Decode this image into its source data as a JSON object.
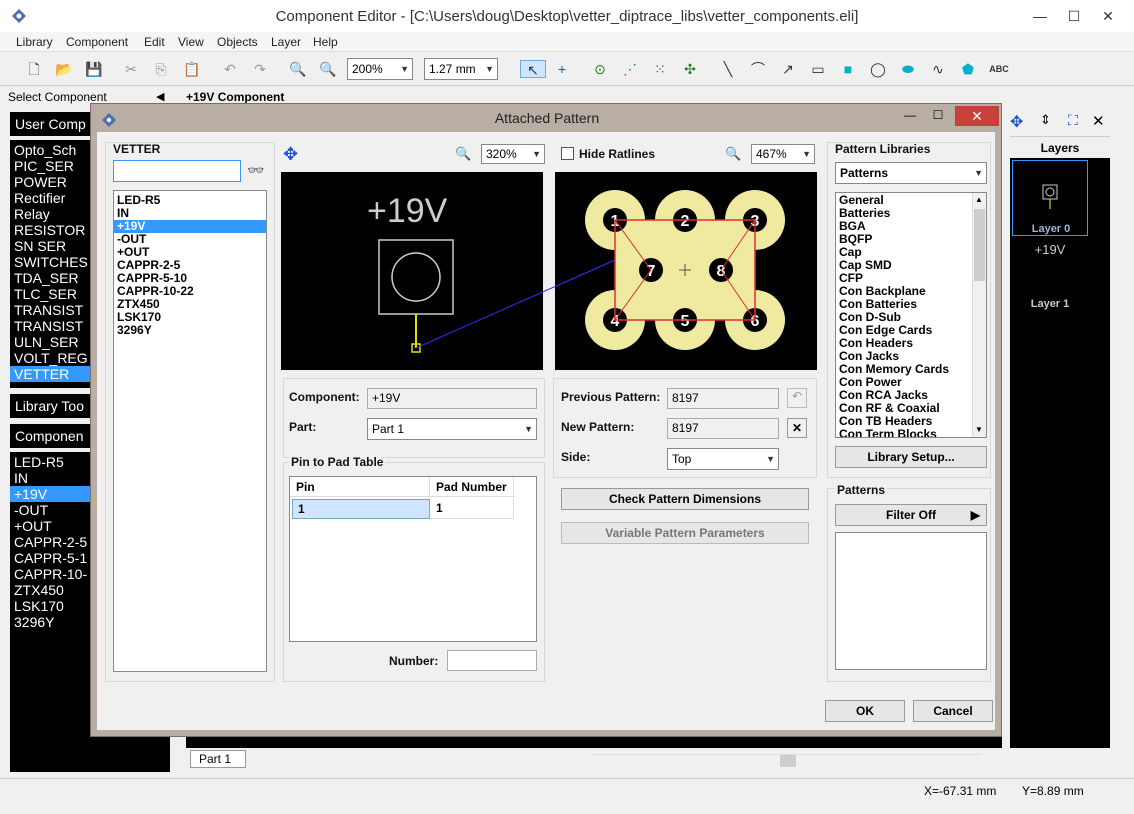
{
  "window": {
    "title": "Component Editor - [C:\\Users\\doug\\Desktop\\vetter_diptrace_libs\\vetter_components.eli]",
    "minimize": "—",
    "maximize": "☐",
    "close": "✕"
  },
  "menu": [
    "Library",
    "Component",
    "Edit",
    "View",
    "Objects",
    "Layer",
    "Help"
  ],
  "toolbar": {
    "zoom_value": "200%",
    "grid_value": "1.27 mm",
    "text_tool": "ABC"
  },
  "left": {
    "select_component_label": "Select Component",
    "user_components_header": "User Comp",
    "libraries": [
      "Opto_Sch",
      "PIC_SER",
      "POWER",
      "Rectifier",
      "Relay",
      "RESISTOR",
      "SN SER",
      "SWITCHES",
      "TDA_SER",
      "TLC_SER",
      "TRANSIST",
      "TRANSIST",
      "ULN_SER",
      "VOLT_REG",
      "VETTER"
    ],
    "library_tools_header": "Library Too",
    "components_header": "Componen",
    "components": [
      "LED-R5",
      "IN",
      "+19V",
      "-OUT",
      "+OUT",
      "CAPPR-2-5",
      "CAPPR-5-1",
      "CAPPR-10-",
      "ZTX450",
      "LSK170",
      "3296Y"
    ]
  },
  "editor_header": "+19V Component",
  "layers": {
    "title": "Layers",
    "layer0": "Layer 0",
    "layer1_text": "+19V",
    "layer1": "Layer 1"
  },
  "part_tab": "Part 1",
  "status": {
    "x": "X=-67.31 mm",
    "y": "Y=8.89 mm"
  },
  "dialog": {
    "title": "Attached Pattern",
    "library_label": "VETTER",
    "search_value": "",
    "components": [
      "LED-R5",
      "IN",
      "+19V",
      "-OUT",
      "+OUT",
      "CAPPR-2-5",
      "CAPPR-5-10",
      "CAPPR-10-22",
      "ZTX450",
      "LSK170",
      "3296Y"
    ],
    "zoom_left": "320%",
    "hide_ratlines": "Hide Ratlines",
    "zoom_right": "467%",
    "symbol_text": "+19V",
    "component_label": "Component:",
    "component_value": "+19V",
    "part_label": "Part:",
    "part_value": "Part 1",
    "pin_table_title": "Pin to Pad Table",
    "pin_header": "Pin",
    "pad_header": "Pad Number",
    "pin_rows": [
      {
        "pin": "1",
        "pad": "1"
      }
    ],
    "number_label": "Number:",
    "number_value": "",
    "previous_pattern_label": "Previous Pattern:",
    "previous_pattern_value": "8197",
    "new_pattern_label": "New Pattern:",
    "new_pattern_value": "8197",
    "side_label": "Side:",
    "side_value": "Top",
    "check_dims": "Check Pattern Dimensions",
    "variable_params": "Variable Pattern Parameters",
    "pattern_libraries_label": "Pattern Libraries",
    "pattern_libraries_value": "Patterns",
    "pattern_libs": [
      "General",
      "Batteries",
      "BGA",
      "BQFP",
      "Cap",
      "Cap SMD",
      "CFP",
      "Con Backplane",
      "Con Batteries",
      "Con D-Sub",
      "Con Edge Cards",
      "Con Headers",
      "Con Jacks",
      "Con Memory Cards",
      "Con Power",
      "Con RCA Jacks",
      "Con RF & Coaxial",
      "Con TB Headers",
      "Con Term Blocks"
    ],
    "library_setup": "Library Setup...",
    "patterns_label": "Patterns",
    "filter": "Filter Off",
    "ok": "OK",
    "cancel": "Cancel",
    "pads": [
      "1",
      "2",
      "3",
      "7",
      "8",
      "4",
      "5",
      "6"
    ]
  }
}
